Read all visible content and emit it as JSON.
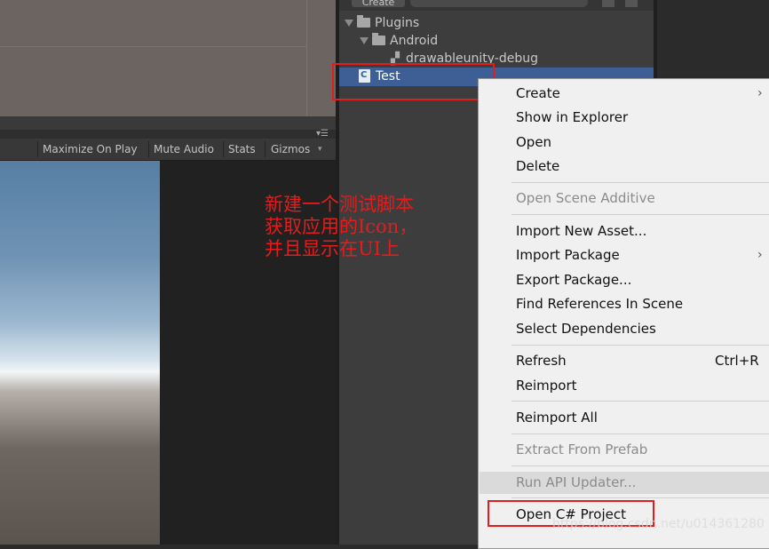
{
  "game_toolbar": {
    "maximize": "Maximize On Play",
    "mute": "Mute Audio",
    "stats": "Stats",
    "gizmos": "Gizmos"
  },
  "project": {
    "create_label": "Create",
    "tree": [
      {
        "label": "Plugins",
        "icon": "folder-icon"
      },
      {
        "label": "Android",
        "icon": "folder-icon"
      },
      {
        "label": "drawableunity-debug",
        "icon": "plugin-icon"
      },
      {
        "label": "Test",
        "icon": "csharp-script-icon",
        "selected": true
      }
    ]
  },
  "annotation": {
    "line1": "新建一个测试脚本",
    "line2": "获取应用的Icon，",
    "line3": "并且显示在UI上"
  },
  "context_menu": {
    "items": [
      {
        "label": "Create",
        "submenu": true
      },
      {
        "label": "Show in Explorer"
      },
      {
        "label": "Open"
      },
      {
        "label": "Delete"
      },
      {
        "label": "Open Scene Additive",
        "disabled": true
      },
      {
        "label": "Import New Asset..."
      },
      {
        "label": "Import Package",
        "submenu": true
      },
      {
        "label": "Export Package..."
      },
      {
        "label": "Find References In Scene"
      },
      {
        "label": "Select Dependencies"
      },
      {
        "label": "Refresh",
        "shortcut": "Ctrl+R"
      },
      {
        "label": "Reimport"
      },
      {
        "label": "Reimport All"
      },
      {
        "label": "Extract From Prefab",
        "disabled": true
      },
      {
        "label": "Run API Updater...",
        "disabled": true
      },
      {
        "label": "Open C# Project"
      }
    ]
  },
  "watermark": "https://blog.csdn.net/u014361280",
  "colors": {
    "selection": "#3e5f96",
    "annotation_red": "#e31d1d"
  }
}
